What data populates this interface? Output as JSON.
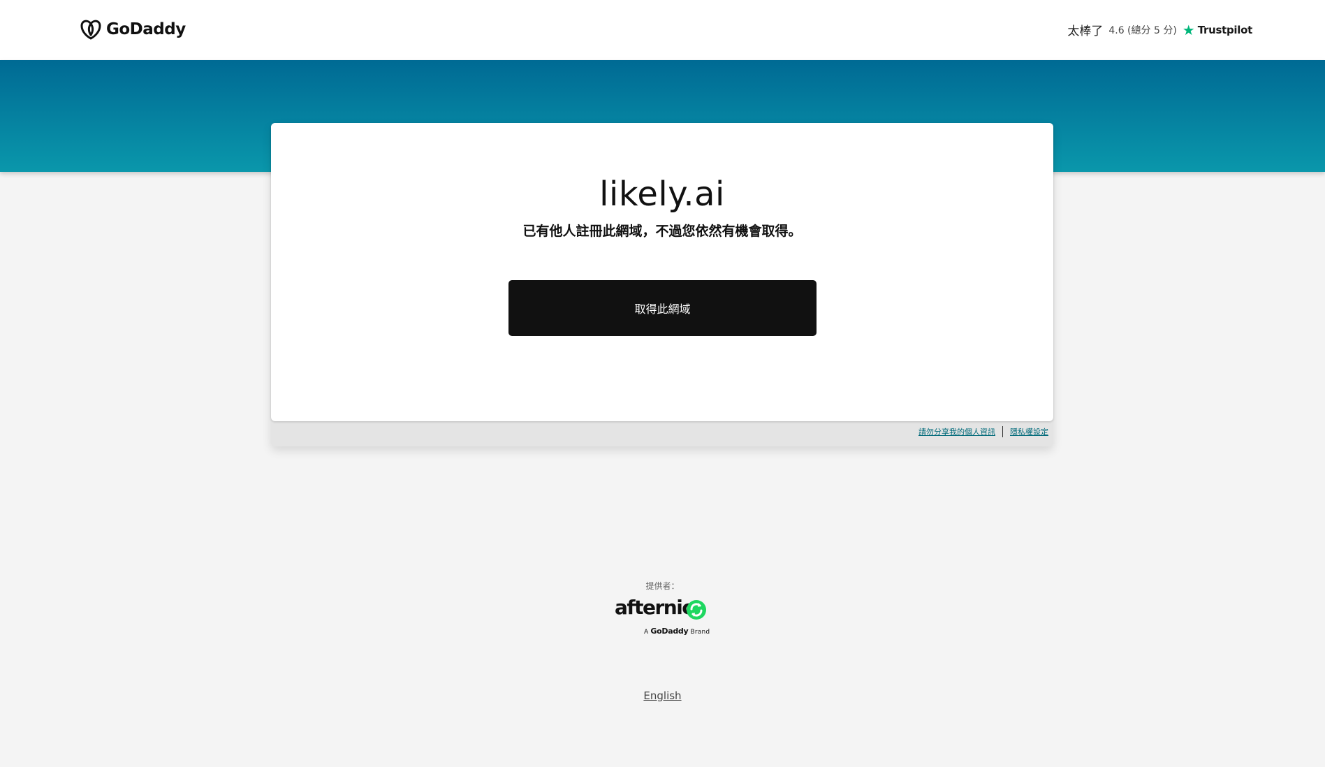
{
  "header": {
    "brand": "GoDaddy",
    "rating": {
      "word": "太棒了",
      "score_text": "4.6 (總分 5 分)",
      "brand": "Trustpilot",
      "star_color": "#00b67a"
    }
  },
  "main": {
    "domain": "likely.ai",
    "message": "已有他人註冊此網域，不過您依然有機會取得。",
    "cta_label": "取得此網域"
  },
  "card_footer": {
    "links": [
      {
        "label": "請勿分享我的個人資訊"
      },
      {
        "label": "隱私權設定"
      }
    ]
  },
  "footer": {
    "provider_label": "提供者：",
    "afternic_name": "afternic",
    "afternic_sub_prefix": "A",
    "afternic_sub_brand": "GoDaddy",
    "afternic_sub_suffix": "Brand",
    "language_link": "English"
  },
  "colors": {
    "banner_top": "#006a94",
    "banner_bottom": "#0a97ab",
    "button_bg": "#111111",
    "afternic_green": "#1ed760"
  }
}
